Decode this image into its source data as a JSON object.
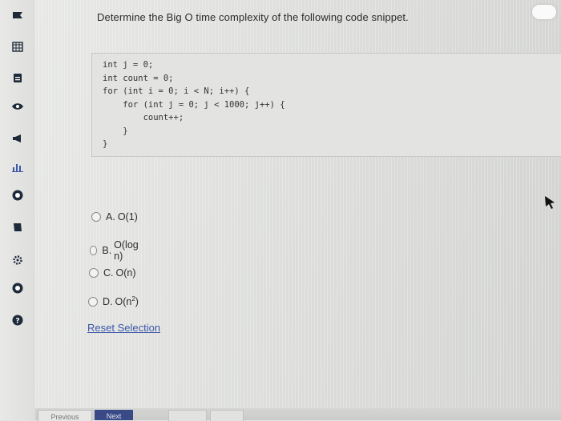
{
  "question": {
    "text": "Determine the Big O time complexity of the following code snippet."
  },
  "code": {
    "lines": [
      "int j = 0;",
      "int count = 0;",
      "for (int i = 0; i < N; i++) {",
      "    for (int j = 0; j < 1000; j++) {",
      "        count++;",
      "    }",
      "}"
    ]
  },
  "options": [
    {
      "letter": "A.",
      "text": "O(1)"
    },
    {
      "letter": "B.",
      "text": "O(log n)"
    },
    {
      "letter": "C.",
      "text": "O(n)"
    },
    {
      "letter": "D.",
      "text": "O(n",
      "sup": "2",
      "tail": ")"
    }
  ],
  "reset_label": "Reset Selection",
  "nav": {
    "previous_label": "Previous",
    "next_label": "Next"
  },
  "sidebar": {
    "icons": [
      "inbox-icon",
      "calendar-icon",
      "clipboard-icon",
      "eye-icon",
      "megaphone-icon",
      "bar-chart-icon",
      "help-circle-icon",
      "notebook-icon",
      "gear-icon",
      "help-circle-icon",
      "question-icon"
    ]
  },
  "colors": {
    "link": "#3b57a7",
    "next_button": "#3a4a86"
  }
}
